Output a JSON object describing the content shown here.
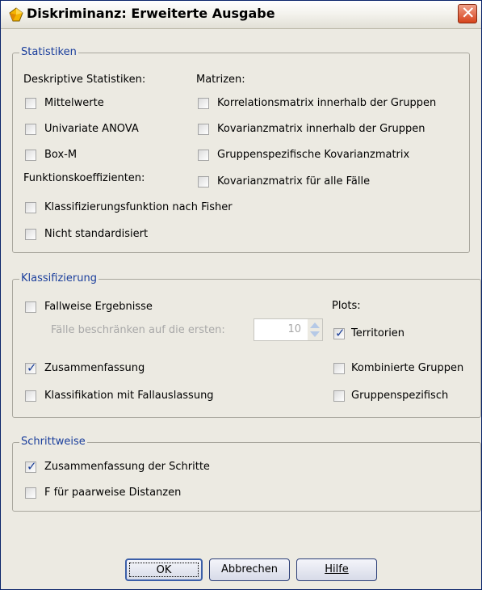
{
  "window": {
    "title": "Diskriminanz: Erweiterte Ausgabe"
  },
  "statistiken": {
    "legend": "Statistiken",
    "deskriptive_label": "Deskriptive Statistiken:",
    "deskriptive": [
      {
        "label": "Mittelwerte",
        "checked": false
      },
      {
        "label": "Univariate ANOVA",
        "checked": false
      },
      {
        "label": "Box-M",
        "checked": false
      }
    ],
    "funktion_label": "Funktionskoeffizienten:",
    "funktion": [
      {
        "label": "Klassifizierungsfunktion nach Fisher",
        "checked": false
      },
      {
        "label": "Nicht standardisiert",
        "checked": false
      }
    ],
    "matrizen_label": "Matrizen:",
    "matrizen": [
      {
        "label": "Korrelationsmatrix innerhalb der Gruppen",
        "checked": false
      },
      {
        "label": "Kovarianzmatrix innerhalb der Gruppen",
        "checked": false
      },
      {
        "label": "Gruppenspezifische Kovarianzmatrix",
        "checked": false
      },
      {
        "label": "Kovarianzmatrix für alle Fälle",
        "checked": false
      }
    ]
  },
  "klassifizierung": {
    "legend": "Klassifizierung",
    "fallweise": {
      "label": "Fallweise Ergebnisse",
      "checked": false
    },
    "limit_label": "Fälle beschränken auf die ersten:",
    "limit_value": "10",
    "zusammenfassung": {
      "label": "Zusammenfassung",
      "checked": true
    },
    "fallauslassung": {
      "label": "Klassifikation mit Fallauslassung",
      "checked": false
    },
    "plots_label": "Plots:",
    "plots": [
      {
        "label": "Territorien",
        "checked": true
      },
      {
        "label": "Kombinierte Gruppen",
        "checked": false
      },
      {
        "label": "Gruppenspezifisch",
        "checked": false
      }
    ]
  },
  "schrittweise": {
    "legend": "Schrittweise",
    "items": [
      {
        "label": "Zusammenfassung der Schritte",
        "checked": true
      },
      {
        "label": "F für paarweise Distanzen",
        "checked": false
      }
    ]
  },
  "buttons": {
    "ok": "OK",
    "cancel": "Abbrechen",
    "help": "Hilfe"
  },
  "colors": {
    "legend": "#1a3e9c",
    "check": "#1b3f98",
    "close": "#d6431b"
  }
}
